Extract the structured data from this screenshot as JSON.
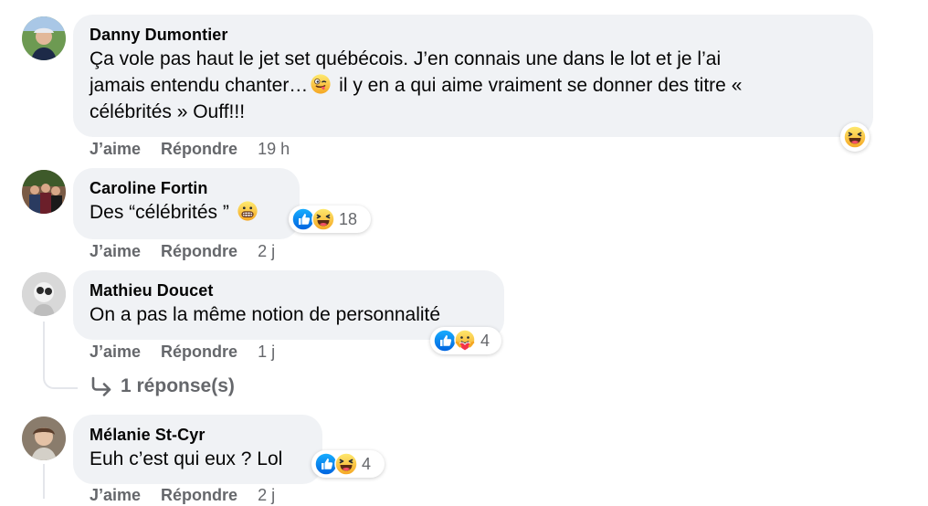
{
  "actions": {
    "like": "J’aime",
    "reply": "Répondre"
  },
  "comments": [
    {
      "author": "Danny Dumontier",
      "text_line1": "Ça vole pas haut le jet set québécois. J’en connais une dans le lot et je l’ai",
      "text_line2a": "jamais entendu chanter…",
      "text_line2b": " il y en a qui aime vraiment se donner des titre «",
      "text_line3": "célébrités » Ouff!!!",
      "time": "19 h",
      "reaction_icons": [
        "laughing-emoji-icon"
      ]
    },
    {
      "author": "Caroline Fortin",
      "text": "Des “célébrités ” ",
      "time": "2 j",
      "reaction_icons": [
        "like-icon",
        "haha-icon"
      ],
      "reaction_count": "18"
    },
    {
      "author": "Mathieu Doucet",
      "text": "On a pas la même notion de personnalité",
      "time": "1 j",
      "reaction_icons": [
        "like-icon",
        "care-icon"
      ],
      "reaction_count": "4",
      "replies_label": "1 réponse(s)"
    },
    {
      "author": "Mélanie St-Cyr",
      "text": "Euh c’est qui eux ? Lol",
      "time": "2 j",
      "reaction_icons": [
        "like-icon",
        "haha-icon"
      ],
      "reaction_count": "4"
    }
  ],
  "colors": {
    "bubble": "#f0f2f5",
    "meta_text": "#65676b",
    "like_blue": "#1877f2",
    "emoji_yellow": "#f7c23a"
  }
}
